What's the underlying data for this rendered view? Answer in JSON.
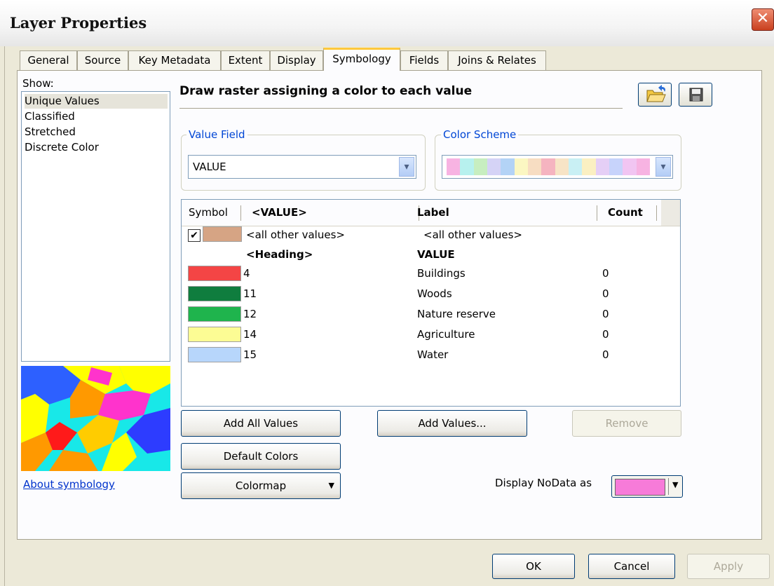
{
  "window": {
    "title": "Layer Properties",
    "close_glyph": "✕"
  },
  "tabs": [
    {
      "label": "General"
    },
    {
      "label": "Source"
    },
    {
      "label": "Key Metadata"
    },
    {
      "label": "Extent"
    },
    {
      "label": "Display"
    },
    {
      "label": "Symbology"
    },
    {
      "label": "Fields"
    },
    {
      "label": "Joins & Relates"
    }
  ],
  "show": {
    "label": "Show:",
    "items": [
      "Unique Values",
      "Classified",
      "Stretched",
      "Discrete Color"
    ],
    "selected": "Unique Values"
  },
  "about_link": "About symbology",
  "description": "Draw raster assigning a color to each value",
  "value_field": {
    "legend": "Value Field",
    "value": "VALUE"
  },
  "color_scheme": {
    "legend": "Color Scheme",
    "colors": [
      "#f7b3e2",
      "#b7f1ee",
      "#c7eec0",
      "#d5d3f6",
      "#b3d3f6",
      "#fbf7c2",
      "#f7ddc2",
      "#f5b4c0",
      "#f7e4c6",
      "#c9f0f4",
      "#fbf0c2",
      "#e5cff6",
      "#c7d3fb",
      "#f1c5f2",
      "#f7b3e2"
    ]
  },
  "table": {
    "headers": {
      "symbol": "Symbol",
      "value": "<VALUE>",
      "label": "Label",
      "count": "Count"
    },
    "all_other": {
      "value": "<all other values>",
      "label": "<all other values>",
      "color": "#d6a484",
      "checked": true,
      "check_glyph": "✔"
    },
    "heading": {
      "value": "<Heading>",
      "label": "VALUE"
    },
    "rows": [
      {
        "value": "4",
        "label": "Buildings",
        "count": "0",
        "color": "#f44545"
      },
      {
        "value": "11",
        "label": "Woods",
        "count": "0",
        "color": "#0f7d3e"
      },
      {
        "value": "12",
        "label": "Nature reserve",
        "count": "0",
        "color": "#1fb44d"
      },
      {
        "value": "14",
        "label": "Agriculture",
        "count": "0",
        "color": "#fcfc94"
      },
      {
        "value": "15",
        "label": "Water",
        "count": "0",
        "color": "#b7d6fb"
      }
    ]
  },
  "buttons": {
    "add_all": "Add All Values",
    "add_values": "Add Values...",
    "remove": "Remove",
    "default_colors": "Default Colors",
    "colormap": "Colormap",
    "ok": "OK",
    "cancel": "Cancel",
    "apply": "Apply"
  },
  "nodata": {
    "label": "Display NoData as",
    "color": "#f77bd9"
  }
}
